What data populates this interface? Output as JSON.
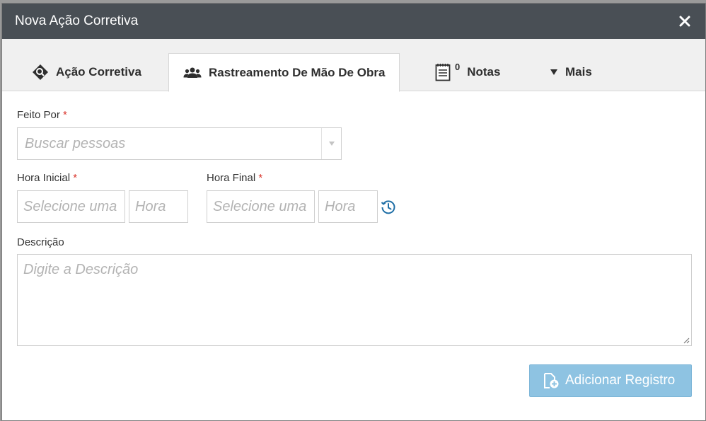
{
  "dialog": {
    "title": "Nova Ação Corretiva",
    "close_label": "✕"
  },
  "tabs": [
    {
      "label": "Ação Corretiva",
      "icon": "tag-search-icon"
    },
    {
      "label": "Rastreamento De Mão De Obra",
      "icon": "people-icon",
      "active": true
    },
    {
      "label": "Notas",
      "count": "0",
      "icon": "notepad-icon"
    },
    {
      "label": "Mais",
      "icon": "caret-down-icon"
    }
  ],
  "form": {
    "feito_por": {
      "label": "Feito Por",
      "required": "*",
      "placeholder": "Buscar pessoas"
    },
    "hora_inicial": {
      "label": "Hora Inicial",
      "required": "*",
      "date_placeholder": "Selecione uma",
      "time_placeholder": "Hora"
    },
    "hora_final": {
      "label": "Hora Final",
      "required": "*",
      "date_placeholder": "Selecione uma",
      "time_placeholder": "Hora"
    },
    "descricao": {
      "label": "Descrição",
      "placeholder": "Digite a Descrição"
    }
  },
  "actions": {
    "add_label": "Adicionar Registro"
  },
  "colors": {
    "titlebar": "#494f55",
    "accent": "#8ec3e2",
    "required": "#d9342b",
    "clock_icon": "#1f6fa6"
  }
}
